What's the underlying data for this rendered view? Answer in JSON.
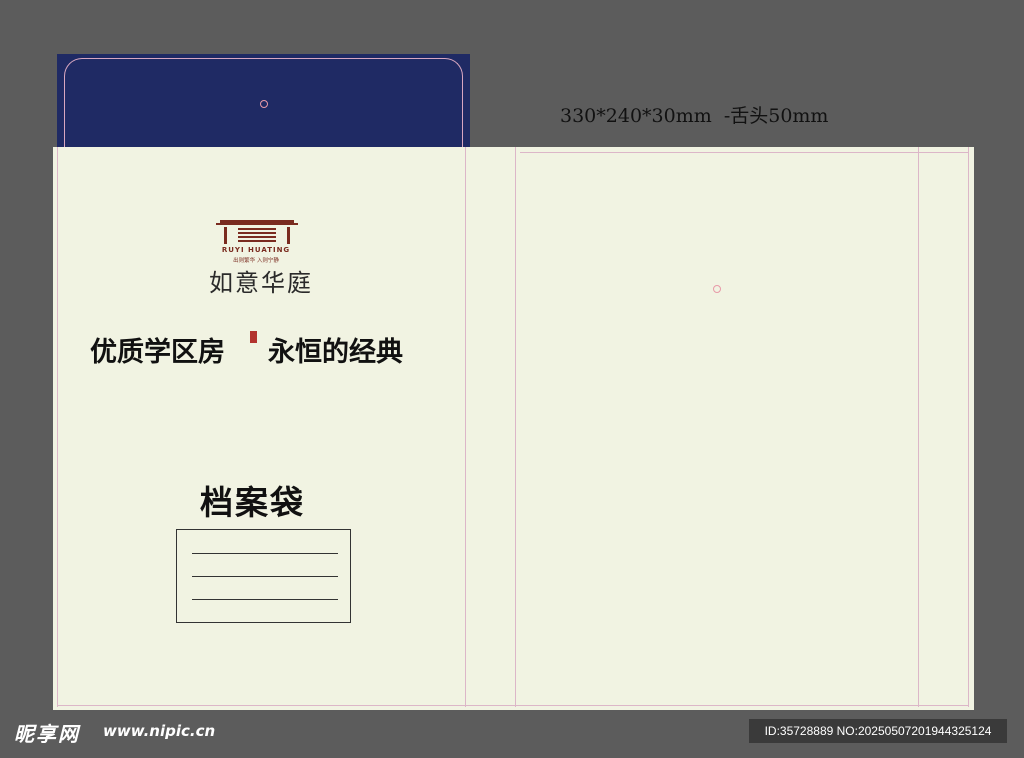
{
  "dimensions_text": "330*240*30mm  -舌头50mm",
  "logo": {
    "english": "RUYI HUATING",
    "tagline": "出则繁华  入则宁静",
    "chinese": "如意华庭"
  },
  "slogan": {
    "left": "优质学区房",
    "right": "永恒的经典"
  },
  "document_title": "档案袋",
  "watermark": {
    "site": "昵享网",
    "url": "www.nipic.cn",
    "id": "ID:35728889 NO:20250507201944325124"
  },
  "colors": {
    "flap": "#1f2a64",
    "paper": "#f1f3e2",
    "background": "#5c5c5c",
    "logo_brown": "#7a2b1f"
  }
}
